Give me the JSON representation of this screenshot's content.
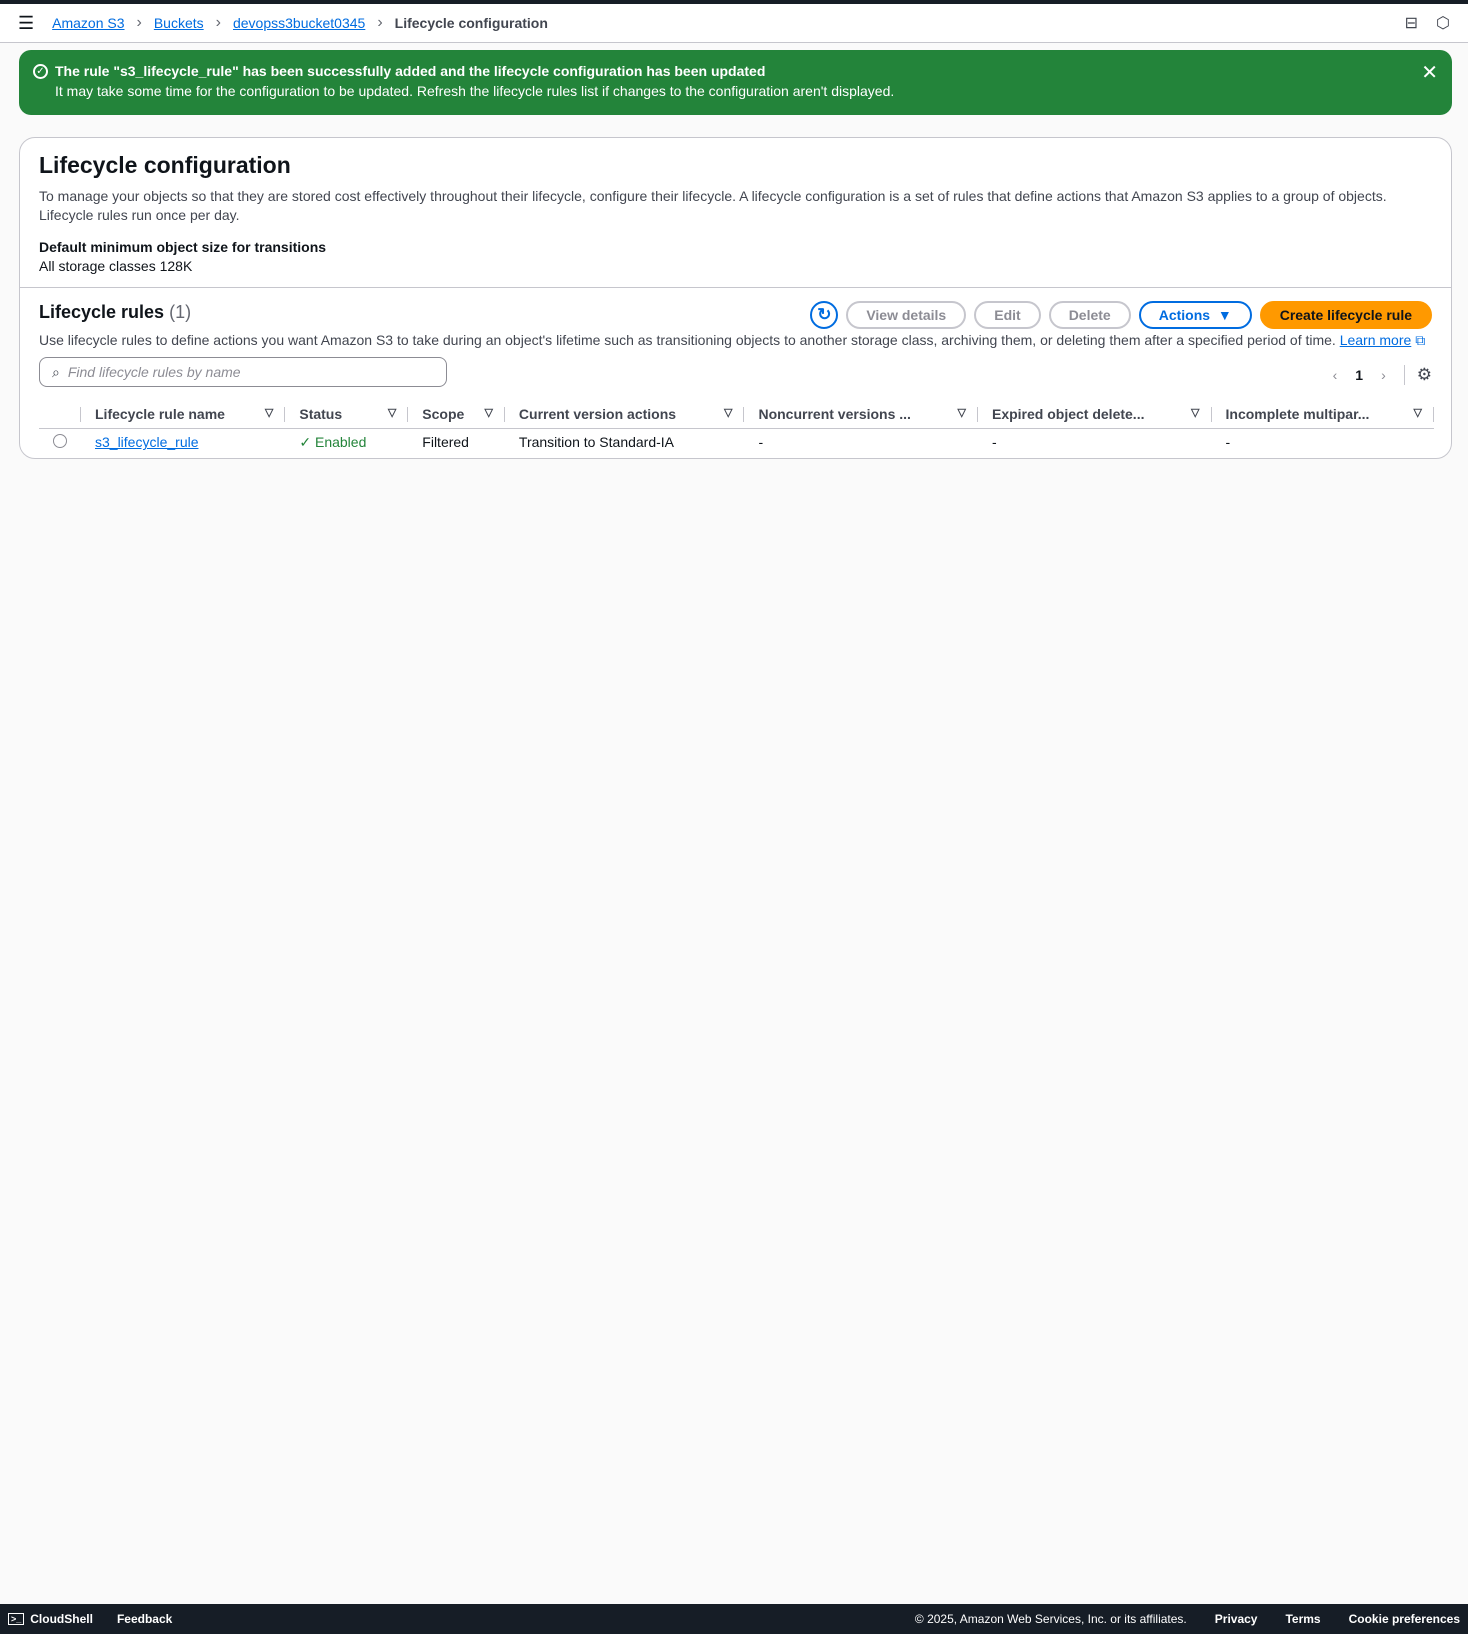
{
  "breadcrumbs": [
    "Amazon S3",
    "Buckets",
    "devopss3bucket0345"
  ],
  "breadcrumb_current": "Lifecycle configuration",
  "banner": {
    "title": "The rule \"s3_lifecycle_rule\" has been successfully added and the lifecycle configuration has been updated",
    "message": "It may take some time for the configuration to be updated. Refresh the lifecycle rules list if changes to the configuration aren't displayed."
  },
  "config": {
    "title": "Lifecycle configuration",
    "description": "To manage your objects so that they are stored cost effectively throughout their lifecycle, configure their lifecycle. A lifecycle configuration is a set of rules that define actions that Amazon S3 applies to a group of objects. Lifecycle rules run once per day.",
    "min_size_label": "Default minimum object size for transitions",
    "min_size_value": "All storage classes 128K"
  },
  "rules": {
    "title": "Lifecycle rules",
    "count": "(1)",
    "view_details": "View details",
    "edit": "Edit",
    "delete": "Delete",
    "actions": "Actions",
    "create": "Create lifecycle rule",
    "description": "Use lifecycle rules to define actions you want Amazon S3 to take during an object's lifetime such as transitioning objects to another storage class, archiving them, or deleting them after a specified period of time.",
    "learn_more": "Learn more",
    "search_placeholder": "Find lifecycle rules by name",
    "page": "1",
    "columns": [
      "Lifecycle rule name",
      "Status",
      "Scope",
      "Current version actions",
      "Noncurrent versions ...",
      "Expired object delete...",
      "Incomplete multipar..."
    ],
    "rows": [
      [
        "s3_lifecycle_rule",
        "Enabled",
        "Filtered",
        "Transition to Standard-IA",
        "-",
        "-",
        "-"
      ]
    ]
  },
  "footer": {
    "cloudshell": "CloudShell",
    "feedback": "Feedback",
    "copyright": "© 2025, Amazon Web Services, Inc. or its affiliates.",
    "privacy": "Privacy",
    "terms": "Terms",
    "cookies": "Cookie preferences"
  }
}
